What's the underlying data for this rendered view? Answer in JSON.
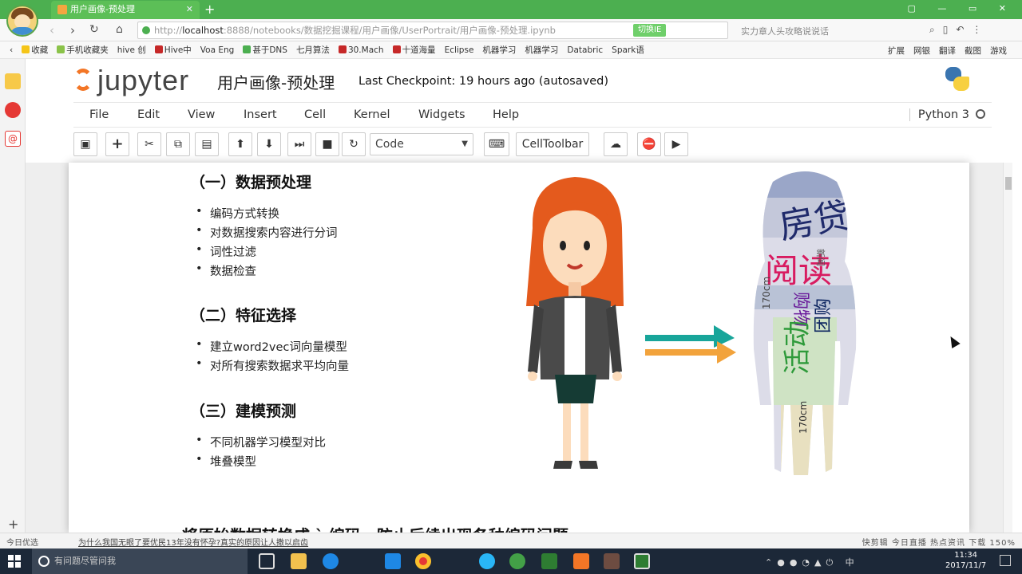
{
  "browser": {
    "tab_title": "用户画像-预处理",
    "url_prefix": "http://",
    "url_host": "localhost",
    "url_path": ":8888/notebooks/数据挖掘课程/用户画像/UserPortrait/用户画像-预处理.ipynb",
    "url_badge": "切换IE",
    "search_hint": "实力章人头攻略说说话",
    "bookmarks": [
      "收藏",
      "手机收藏夹",
      "hive 创",
      "Hive中",
      "Voa Eng",
      "甚于DNS",
      "七月算法",
      "30.Mach",
      "十道海量",
      "Eclipse",
      "机器学习",
      "机器学习",
      "Databric",
      "Spark语"
    ],
    "bookmarks_right": [
      "扩展",
      "网银",
      "翻译",
      "截图",
      "游戏"
    ]
  },
  "jupyter": {
    "logo_text": "jupyter",
    "notebook_name": "用户画像-预处理",
    "checkpoint": "Last Checkpoint: 19 hours ago (autosaved)",
    "menu": [
      "File",
      "Edit",
      "View",
      "Insert",
      "Cell",
      "Kernel",
      "Widgets",
      "Help"
    ],
    "kernel_name": "Python 3",
    "cell_type": "Code",
    "celltoolbar_label": "CellToolbar"
  },
  "notebook": {
    "sections": [
      {
        "title": "（一）数据预处理",
        "items": [
          "编码方式转换",
          "对数据搜索内容进行分词",
          "词性过滤",
          "数据检查"
        ]
      },
      {
        "title": "（二）特征选择",
        "items": [
          "建立word2vec词向量模型",
          "对所有搜索数据求平均向量"
        ]
      },
      {
        "title": "（三）建模预测",
        "items": [
          "不同机器学习模型对比",
          "堆叠模型"
        ]
      }
    ],
    "bottom_text": "将原始数据转换成 ` 编码，防止后续出现各种编码问题",
    "wordcloud_words": [
      "房贷",
      "阅读",
      "购物",
      "170cm",
      "活动",
      "团购",
      "170cm",
      "新闻"
    ]
  },
  "status": {
    "left": "今日优选",
    "news": "为什么我国无眼了要优民13年没有怀孕?真实的原因让人撒以启齿",
    "right": "快剪辑  今日直播  热点资讯  下载  150%"
  },
  "taskbar": {
    "search_placeholder": "有问题尽管问我",
    "time": "11:34",
    "date": "2017/11/7",
    "ime": "中"
  }
}
